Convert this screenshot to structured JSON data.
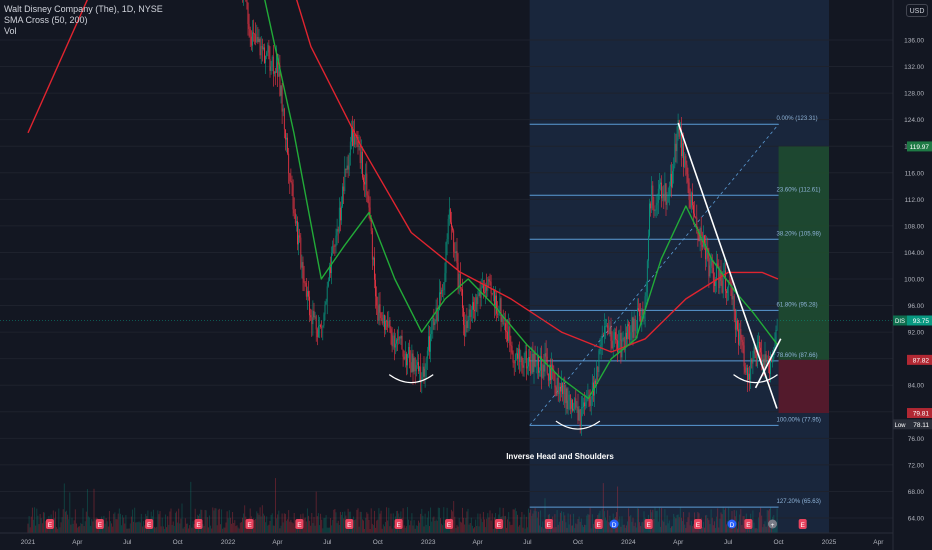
{
  "header": {
    "title": "Walt Disney Company (The), 1D, NYSE",
    "indicator": "SMA Cross (50, 200)",
    "volume": "Vol"
  },
  "currency": "USD",
  "colors": {
    "background": "#131722",
    "candle_up": "#089981",
    "candle_down": "#f23645",
    "sma50": "#22ab38",
    "sma200": "#e0242f",
    "fib": "#5b9bd5",
    "profit_zone": "#1f4d2e",
    "loss_zone": "#5a1a2a",
    "highlight_region": "#1c2a44"
  },
  "chart_data": {
    "type": "candlestick",
    "title": "Walt Disney Company (The), 1D, NYSE",
    "x_ticks": [
      "2021",
      "Apr",
      "Jul",
      "Oct",
      "2022",
      "Apr",
      "Jul",
      "Oct",
      "2023",
      "Apr",
      "Jul",
      "Oct",
      "2024",
      "Apr",
      "Jul",
      "Oct",
      "2025",
      "Apr"
    ],
    "y_ticks": [
      "64.00",
      "68.00",
      "72.00",
      "76.00",
      "80.00",
      "84.00",
      "88.00",
      "92.00",
      "96.00",
      "100.00",
      "104.00",
      "108.00",
      "112.00",
      "116.00",
      "120.00",
      "124.00",
      "128.00",
      "132.00",
      "136.00"
    ],
    "ylim": [
      62.5,
      140
    ],
    "price_path": [
      [
        "2021-01-01",
        170
      ],
      [
        "2021-05-01",
        180
      ],
      [
        "2021-10-01",
        172
      ],
      [
        "2022-01-01",
        155
      ],
      [
        "2022-02-15",
        136
      ],
      [
        "2022-04-01",
        132
      ],
      [
        "2022-05-10",
        105
      ],
      [
        "2022-06-01",
        95
      ],
      [
        "2022-06-20",
        92
      ],
      [
        "2022-08-15",
        122
      ],
      [
        "2022-09-10",
        115
      ],
      [
        "2022-10-01",
        95
      ],
      [
        "2022-11-10",
        90
      ],
      [
        "2022-12-20",
        85
      ],
      [
        "2023-01-25",
        98
      ],
      [
        "2023-02-10",
        110
      ],
      [
        "2023-03-10",
        92
      ],
      [
        "2023-04-10",
        99
      ],
      [
        "2023-05-10",
        96
      ],
      [
        "2023-06-10",
        88
      ],
      [
        "2023-08-01",
        87
      ],
      [
        "2023-09-01",
        83
      ],
      [
        "2023-10-05",
        79
      ],
      [
        "2023-10-25",
        82
      ],
      [
        "2023-11-20",
        92
      ],
      [
        "2023-12-20",
        90
      ],
      [
        "2024-02-01",
        96
      ],
      [
        "2024-02-10",
        112
      ],
      [
        "2024-03-15",
        113
      ],
      [
        "2024-04-01",
        123
      ],
      [
        "2024-04-25",
        111
      ],
      [
        "2024-06-01",
        101
      ],
      [
        "2024-07-01",
        99
      ],
      [
        "2024-08-05",
        86
      ],
      [
        "2024-08-25",
        89
      ],
      [
        "2024-09-12",
        86
      ],
      [
        "2024-09-30",
        93.75
      ]
    ],
    "sma50": [
      [
        "2021-01-01",
        160
      ],
      [
        "2021-07-01",
        180
      ],
      [
        "2022-01-15",
        150
      ],
      [
        "2022-03-01",
        145
      ],
      [
        "2022-05-01",
        122
      ],
      [
        "2022-06-20",
        100
      ],
      [
        "2022-08-01",
        105
      ],
      [
        "2022-09-15",
        110
      ],
      [
        "2022-11-01",
        100
      ],
      [
        "2022-12-20",
        92
      ],
      [
        "2023-02-01",
        97
      ],
      [
        "2023-03-15",
        100
      ],
      [
        "2023-05-01",
        96
      ],
      [
        "2023-07-01",
        90
      ],
      [
        "2023-09-01",
        85
      ],
      [
        "2023-10-20",
        82
      ],
      [
        "2023-12-01",
        88
      ],
      [
        "2024-01-15",
        91
      ],
      [
        "2024-03-01",
        103
      ],
      [
        "2024-04-15",
        111
      ],
      [
        "2024-06-01",
        103
      ],
      [
        "2024-07-15",
        98
      ],
      [
        "2024-08-15",
        95
      ],
      [
        "2024-09-30",
        90
      ]
    ],
    "sma200": [
      [
        "2021-01-01",
        122
      ],
      [
        "2021-06-01",
        150
      ],
      [
        "2021-12-01",
        170
      ],
      [
        "2022-03-01",
        160
      ],
      [
        "2022-06-01",
        135
      ],
      [
        "2022-09-01",
        120
      ],
      [
        "2022-12-01",
        107
      ],
      [
        "2023-03-01",
        101
      ],
      [
        "2023-06-01",
        97
      ],
      [
        "2023-09-01",
        92
      ],
      [
        "2023-12-01",
        89
      ],
      [
        "2024-02-01",
        91
      ],
      [
        "2024-04-15",
        97
      ],
      [
        "2024-07-01",
        101
      ],
      [
        "2024-09-01",
        101
      ],
      [
        "2024-09-30",
        100
      ]
    ],
    "fibonacci": {
      "start_date": "2023-07-05",
      "end_date": "2024-10-01",
      "levels": [
        {
          "label": "0.00% (123.31)",
          "price": 123.31
        },
        {
          "label": "23.60% (112.61)",
          "price": 112.61
        },
        {
          "label": "38.20% (105.98)",
          "price": 105.98
        },
        {
          "label": "61.80% (95.28)",
          "price": 95.28
        },
        {
          "label": "78.60% (87.66)",
          "price": 87.66
        },
        {
          "label": "100.00% (77.95)",
          "price": 77.95
        },
        {
          "label": "127.20% (65.63)",
          "price": 65.63
        }
      ]
    },
    "trend_shading": {
      "start_date": "2023-07-05",
      "end_date": "2025-01-01"
    },
    "position": {
      "start_date": "2024-10-01",
      "end_date": "2025-01-01",
      "entry": 87.82,
      "target": 119.97,
      "stop": 79.81
    },
    "price_badges": [
      {
        "label": "119.97",
        "price": 119.97,
        "color": "#1e7a45"
      },
      {
        "label": "DIS",
        "value": "93.75",
        "price": 93.75,
        "color": "#0e6e4e"
      },
      {
        "label": "87.82",
        "price": 87.82,
        "color": "#b22833"
      },
      {
        "label": "79.81",
        "price": 79.81,
        "color": "#b22833"
      },
      {
        "label": "Low",
        "value": "78.11",
        "price": 78.11,
        "color": "#2a2e39"
      }
    ],
    "current_price": 93.75,
    "annotation": "Inverse Head and Shoulders",
    "shoulder_arcs": [
      {
        "date": "2022-12-01",
        "price": 85
      },
      {
        "date": "2023-10-01",
        "price": 78
      },
      {
        "date": "2024-08-20",
        "price": 85
      }
    ],
    "event_markers": [
      {
        "date": "2021-02-10",
        "kind": "E"
      },
      {
        "date": "2021-05-12",
        "kind": "E"
      },
      {
        "date": "2021-08-10",
        "kind": "E"
      },
      {
        "date": "2021-11-08",
        "kind": "E"
      },
      {
        "date": "2022-02-09",
        "kind": "E"
      },
      {
        "date": "2022-05-11",
        "kind": "E"
      },
      {
        "date": "2022-08-10",
        "kind": "E"
      },
      {
        "date": "2022-11-08",
        "kind": "E"
      },
      {
        "date": "2023-02-08",
        "kind": "E"
      },
      {
        "date": "2023-05-10",
        "kind": "E"
      },
      {
        "date": "2023-08-09",
        "kind": "E"
      },
      {
        "date": "2023-11-08",
        "kind": "E"
      },
      {
        "date": "2023-12-06",
        "kind": "D"
      },
      {
        "date": "2024-02-07",
        "kind": "E"
      },
      {
        "date": "2024-05-07",
        "kind": "E"
      },
      {
        "date": "2024-07-08",
        "kind": "D"
      },
      {
        "date": "2024-08-07",
        "kind": "E"
      },
      {
        "date": "2024-09-20",
        "kind": "+"
      },
      {
        "date": "2024-11-14",
        "kind": "E"
      }
    ],
    "legend": "none",
    "grid": true
  }
}
